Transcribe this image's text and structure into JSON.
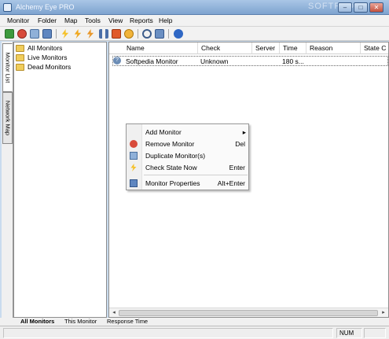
{
  "window": {
    "title": "Alchemy Eye PRO",
    "watermark": "SOFTPEDIA",
    "min_glyph": "–",
    "max_glyph": "□",
    "close_glyph": "✕"
  },
  "menu": [
    "Monitor",
    "Folder",
    "Map",
    "Tools",
    "View",
    "Reports",
    "Help"
  ],
  "toolbar_icons": [
    "add-monitor-icon",
    "remove-monitor-icon",
    "duplicate-icon",
    "properties-icon",
    "check-icon",
    "check-all-icon",
    "check-folder-icon",
    "pause-icon",
    "stop-icon",
    "alert-icon",
    "find-icon",
    "settings-icon",
    "info-icon"
  ],
  "side_tabs": [
    "Monitor List",
    "Network Map"
  ],
  "tree": [
    "All Monitors",
    "Live Monitors",
    "Dead Monitors"
  ],
  "list": {
    "columns": [
      "Name",
      "Check",
      "Server",
      "Time",
      "Reason",
      "State C"
    ],
    "row": {
      "name": "Softpedia Monitor",
      "check": "Unknown",
      "server": "",
      "time": "180 s...",
      "reason": "",
      "state": ""
    },
    "row_icon": "?"
  },
  "context_menu": {
    "items": [
      {
        "label": "Add Monitor",
        "shortcut": "",
        "icon": "",
        "submenu": "▸"
      },
      {
        "label": "Remove Monitor",
        "shortcut": "Del",
        "icon": "remove-monitor-icon"
      },
      {
        "label": "Duplicate Monitor(s)",
        "shortcut": "",
        "icon": "duplicate-icon"
      },
      {
        "label": "Check State Now",
        "shortcut": "Enter",
        "icon": "lightning-icon"
      },
      {
        "label": "Monitor Properties",
        "shortcut": "Alt+Enter",
        "icon": "properties-icon"
      }
    ]
  },
  "bottom_tabs": [
    "All Monitors",
    "This Monitor",
    "Response Time"
  ],
  "status": {
    "pane_num": "NUM"
  },
  "scroll": {
    "left": "◂",
    "right": "▸"
  }
}
